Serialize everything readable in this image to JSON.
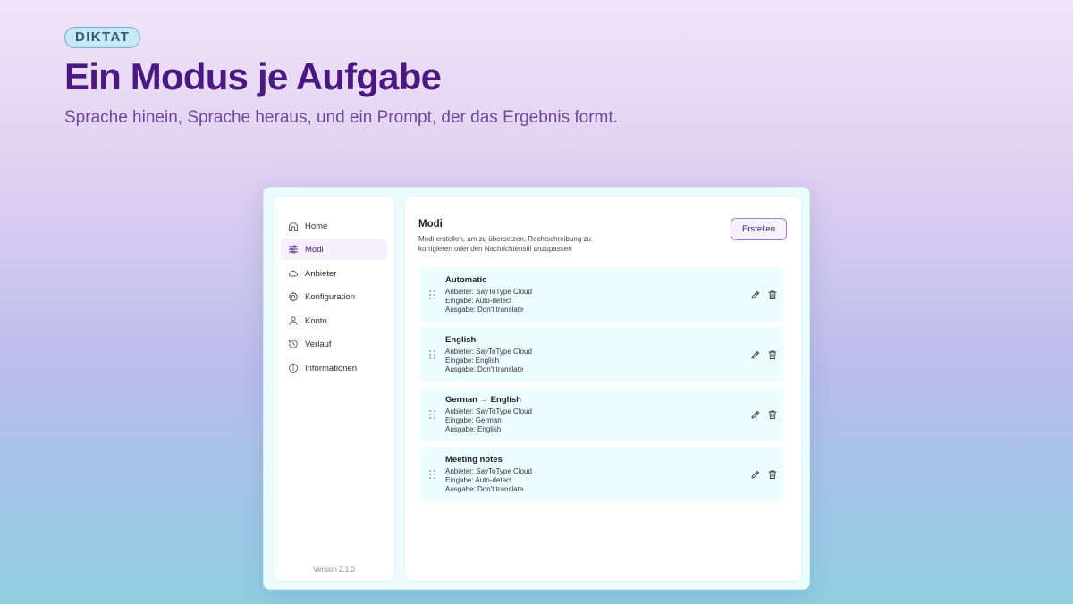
{
  "hero": {
    "badge": "DIKTAT",
    "title": "Ein Modus je Aufgabe",
    "subtitle": "Sprache hinein, Sprache heraus, und ein Prompt, der das Ergebnis formt."
  },
  "sidebar": {
    "items": [
      {
        "label": "Home",
        "icon": "home-icon"
      },
      {
        "label": "Modi",
        "icon": "sliders-icon",
        "active": true
      },
      {
        "label": "Anbieter",
        "icon": "cloud-icon"
      },
      {
        "label": "Konfiguration",
        "icon": "gear-icon"
      },
      {
        "label": "Konto",
        "icon": "user-icon"
      },
      {
        "label": "Verlauf",
        "icon": "history-icon"
      },
      {
        "label": "Informationen",
        "icon": "info-icon"
      }
    ],
    "version": "Version 2.1.0"
  },
  "main": {
    "title": "Modi",
    "description": "Modi erstellen, um zu übersetzen, Rechtschreibung zu korrigieren oder den Nachrichtenstil anzupassen",
    "create_label": "Erstellen",
    "modes": [
      {
        "name": "Automatic",
        "provider": "Anbieter: SayToType Cloud",
        "input": "Eingabe: Auto-detect",
        "output": "Ausgabe: Don't translate"
      },
      {
        "name": "English",
        "provider": "Anbieter: SayToType Cloud",
        "input": "Eingabe: English",
        "output": "Ausgabe: Don't translate"
      },
      {
        "name": "German → English",
        "provider": "Anbieter: SayToType Cloud",
        "input": "Eingabe: German",
        "output": "Ausgabe: English"
      },
      {
        "name": "Meeting notes",
        "provider": "Anbieter: SayToType Cloud",
        "input": "Eingabe: Auto-detect",
        "output": "Ausgabe: Don't translate"
      }
    ]
  },
  "colors": {
    "accent": "#4b1780",
    "badge_border": "#69b3de",
    "card_background": "#eefdfd"
  }
}
